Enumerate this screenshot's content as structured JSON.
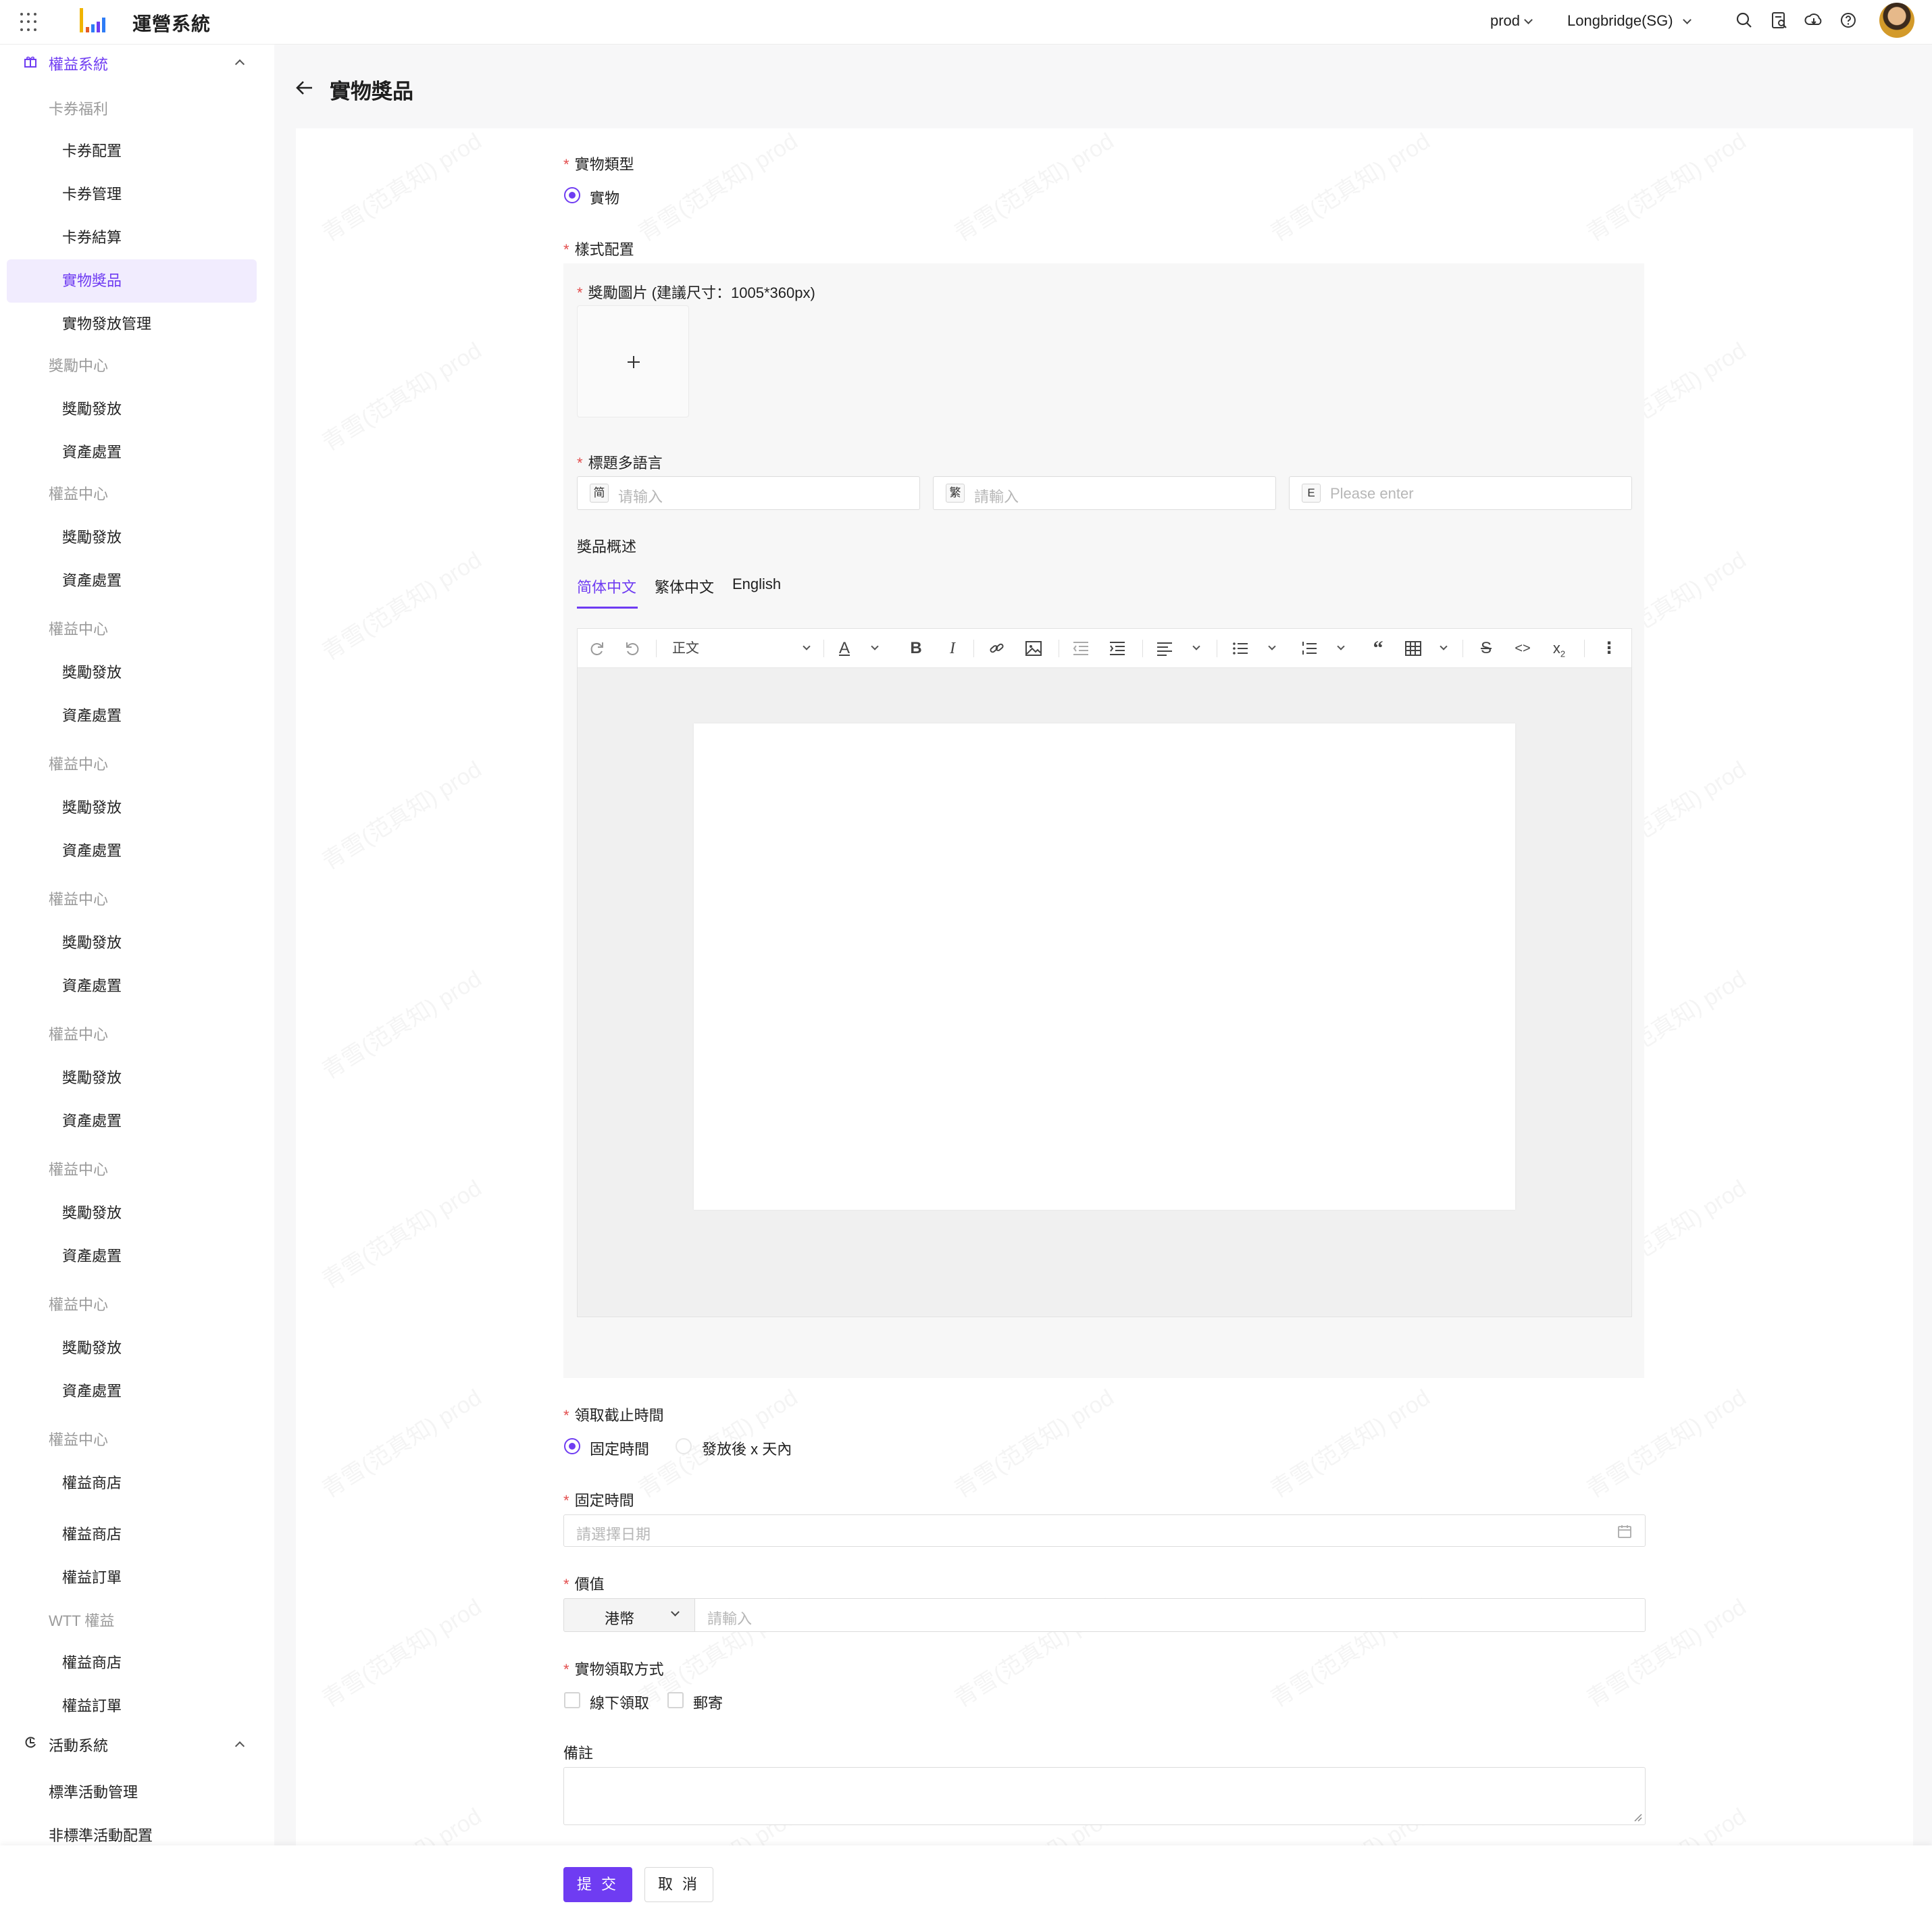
{
  "app": {
    "title": "運營系統"
  },
  "topbar": {
    "env": "prod",
    "region": "Longbridge(SG)"
  },
  "colors": {
    "accent": "#6f3cf2",
    "required": "#e34d4d"
  },
  "icons": {
    "apps": "grid-icon",
    "search": "search-icon",
    "doc": "document-search-icon",
    "download": "cloud-download-icon",
    "help": "help-icon"
  },
  "sidebar": {
    "section1": "權益系統",
    "items": [
      {
        "label": "卡券福利",
        "kind": "group"
      },
      {
        "label": "卡券配置",
        "kind": "item"
      },
      {
        "label": "卡券管理",
        "kind": "item"
      },
      {
        "label": "卡券結算",
        "kind": "item"
      },
      {
        "label": "實物獎品",
        "kind": "active"
      },
      {
        "label": "實物發放管理",
        "kind": "item"
      },
      {
        "label": "獎勵中心",
        "kind": "group"
      },
      {
        "label": "獎勵發放",
        "kind": "item"
      },
      {
        "label": "資產處置",
        "kind": "item"
      },
      {
        "label": "權益中心",
        "kind": "group"
      },
      {
        "label": "獎勵發放",
        "kind": "item"
      },
      {
        "label": "資產處置",
        "kind": "item"
      },
      {
        "label": "權益中心",
        "kind": "group"
      },
      {
        "label": "獎勵發放",
        "kind": "item"
      },
      {
        "label": "資產處置",
        "kind": "item"
      },
      {
        "label": "權益中心",
        "kind": "group"
      },
      {
        "label": "獎勵發放",
        "kind": "item"
      },
      {
        "label": "資產處置",
        "kind": "item"
      },
      {
        "label": "權益中心",
        "kind": "group"
      },
      {
        "label": "獎勵發放",
        "kind": "item"
      },
      {
        "label": "資產處置",
        "kind": "item"
      },
      {
        "label": "權益中心",
        "kind": "group"
      },
      {
        "label": "獎勵發放",
        "kind": "item"
      },
      {
        "label": "資產處置",
        "kind": "item"
      },
      {
        "label": "權益中心",
        "kind": "group"
      },
      {
        "label": "獎勵發放",
        "kind": "item"
      },
      {
        "label": "資產處置",
        "kind": "item"
      },
      {
        "label": "權益中心",
        "kind": "group"
      },
      {
        "label": "獎勵發放",
        "kind": "item"
      },
      {
        "label": "資產處置",
        "kind": "item"
      },
      {
        "label": "權益中心",
        "kind": "group"
      },
      {
        "label": "權益商店",
        "kind": "item"
      },
      {
        "label": "權益商店",
        "kind": "item"
      },
      {
        "label": "權益訂單",
        "kind": "item"
      },
      {
        "label": "WTT 權益",
        "kind": "group"
      },
      {
        "label": "權益商店",
        "kind": "item"
      },
      {
        "label": "權益訂單",
        "kind": "item"
      }
    ],
    "section2": "活動系統",
    "items2": [
      {
        "label": "標準活動管理"
      },
      {
        "label": "非標準活動配置"
      }
    ]
  },
  "page": {
    "title": "實物獎品"
  },
  "form": {
    "type_label": "實物類型",
    "type_option": "實物",
    "style_label": "樣式配置",
    "image_label": "獎勵圖片 (建議尺寸：1005*360px)",
    "title_label": "標題多語言",
    "title_inputs": [
      {
        "tag": "简",
        "placeholder": "请输入"
      },
      {
        "tag": "繁",
        "placeholder": "請輸入"
      },
      {
        "tag": "E",
        "placeholder": "Please enter"
      }
    ],
    "desc_label": "獎品概述",
    "tabs": [
      "简体中文",
      "繁体中文",
      "English"
    ],
    "editor": {
      "paragraph": "正文"
    },
    "deadline_label": "領取截止時間",
    "deadline_options": [
      "固定時間",
      "發放後 x 天內"
    ],
    "fixed_label": "固定時間",
    "date_placeholder": "請選擇日期",
    "value_label": "價值",
    "currency": "港幣",
    "value_placeholder": "請輸入",
    "method_label": "實物領取方式",
    "methods": [
      "線下領取",
      "郵寄"
    ],
    "remark_label": "備註"
  },
  "buttons": {
    "submit": "提 交",
    "cancel": "取 消"
  },
  "watermark": "青雪(范真知) prod"
}
